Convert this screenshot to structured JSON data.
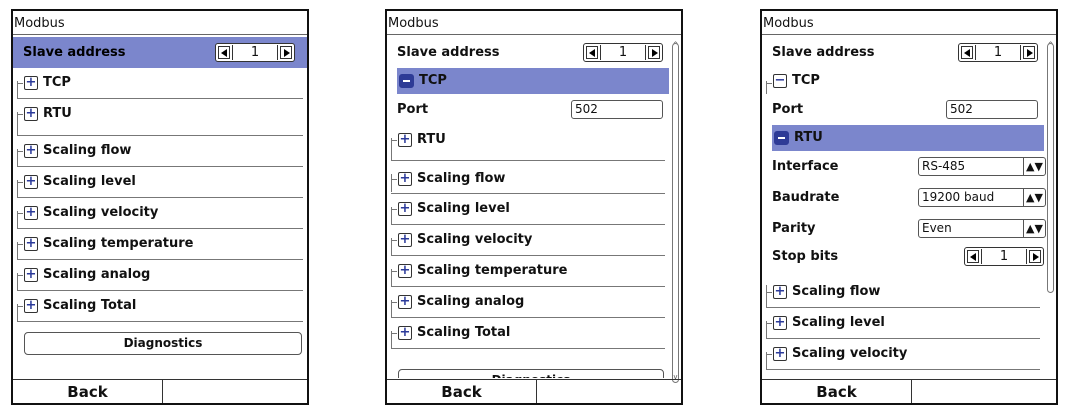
{
  "screens": [
    {
      "title": "Modbus",
      "slave_label": "Slave address",
      "slave_value": "1",
      "groups": [
        "TCP",
        "RTU",
        "Scaling flow",
        "Scaling level",
        "Scaling velocity",
        "Scaling temperature",
        "Scaling analog",
        "Scaling Total"
      ],
      "diagnostics": "Diagnostics",
      "back": "Back"
    },
    {
      "title": "Modbus",
      "slave_label": "Slave address",
      "slave_value": "1",
      "tcp": "TCP",
      "port_label": "Port",
      "port_value": "502",
      "groups": [
        "RTU",
        "Scaling flow",
        "Scaling level",
        "Scaling velocity",
        "Scaling temperature",
        "Scaling analog",
        "Scaling Total"
      ],
      "diagnostics": "Diagnostics",
      "back": "Back"
    },
    {
      "title": "Modbus",
      "slave_label": "Slave address",
      "slave_value": "1",
      "tcp": "TCP",
      "port_label": "Port",
      "port_value": "502",
      "rtu": "RTU",
      "interface_label": "Interface",
      "interface_value": "RS-485",
      "baudrate_label": "Baudrate",
      "baudrate_value": "19200 baud",
      "parity_label": "Parity",
      "parity_value": "Even",
      "stopbits_label": "Stop bits",
      "stopbits_value": "1",
      "groups": [
        "Scaling flow",
        "Scaling level",
        "Scaling velocity"
      ],
      "back": "Back"
    }
  ],
  "icons": {
    "expand": "plus-icon",
    "collapse": "minus-icon",
    "dec": "arrow-left-icon",
    "inc": "arrow-right-icon",
    "dropdown": "updown-icon"
  },
  "colors": {
    "selection": "#7b86cc",
    "icon": "#2e3b96"
  }
}
